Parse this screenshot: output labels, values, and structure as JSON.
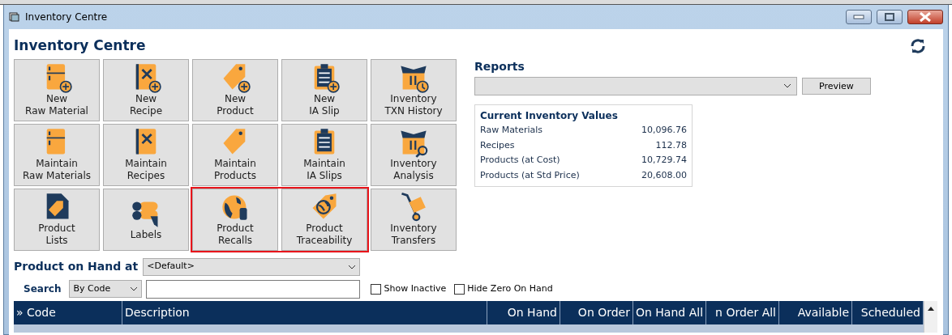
{
  "window": {
    "title": "Inventory Centre"
  },
  "heading": "Inventory Centre",
  "tiles": [
    {
      "label": "New\nRaw Material",
      "kind": "fridgeadd",
      "highlighted": false
    },
    {
      "label": "New\nRecipe",
      "kind": "recipeadd",
      "highlighted": false
    },
    {
      "label": "New\nProduct",
      "kind": "tagadd",
      "highlighted": false
    },
    {
      "label": "New\nIA Slip",
      "kind": "clipboardadd",
      "highlighted": false
    },
    {
      "label": "Inventory\nTXN History",
      "kind": "boxclock",
      "highlighted": false
    },
    {
      "label": "Maintain\nRaw Materials",
      "kind": "fridge",
      "highlighted": false
    },
    {
      "label": "Maintain\nRecipes",
      "kind": "recipe",
      "highlighted": false
    },
    {
      "label": "Maintain\nProducts",
      "kind": "tag",
      "highlighted": false
    },
    {
      "label": "Maintain\nIA Slips",
      "kind": "clipboard",
      "highlighted": false
    },
    {
      "label": "Inventory\nAnalysis",
      "kind": "boxsearch",
      "highlighted": false
    },
    {
      "label": "Product\nLists",
      "kind": "taglist",
      "highlighted": false
    },
    {
      "label": "Labels",
      "kind": "rolls",
      "highlighted": false
    },
    {
      "label": "Product\nRecalls",
      "kind": "globe",
      "highlighted": true
    },
    {
      "label": "Product\nTraceability",
      "kind": "globetag",
      "highlighted": true
    },
    {
      "label": "Inventory\nTransfers",
      "kind": "trolley",
      "highlighted": false
    }
  ],
  "reports": {
    "title": "Reports",
    "button": "Preview"
  },
  "values": {
    "title": "Current Inventory Values",
    "rows": [
      {
        "label": "Raw Materials",
        "value": "10,096.76"
      },
      {
        "label": "Recipes",
        "value": "112.78"
      },
      {
        "label": "Products (at Cost)",
        "value": "10,729.74"
      },
      {
        "label": "Products (at Std Price)",
        "value": "20,608.00"
      }
    ]
  },
  "on_hand": {
    "label": "Product on Hand at",
    "location": "<Default>"
  },
  "search": {
    "label": "Search",
    "mode": "By Code",
    "options": [
      {
        "label": "Show Inactive",
        "checked": false
      },
      {
        "label": "Hide Zero On Hand",
        "checked": false
      }
    ]
  },
  "table": {
    "columns": [
      "» Code",
      "Description",
      "On Hand",
      "On Order",
      "On Hand All",
      "n Order All",
      "Available",
      "Scheduled"
    ]
  }
}
